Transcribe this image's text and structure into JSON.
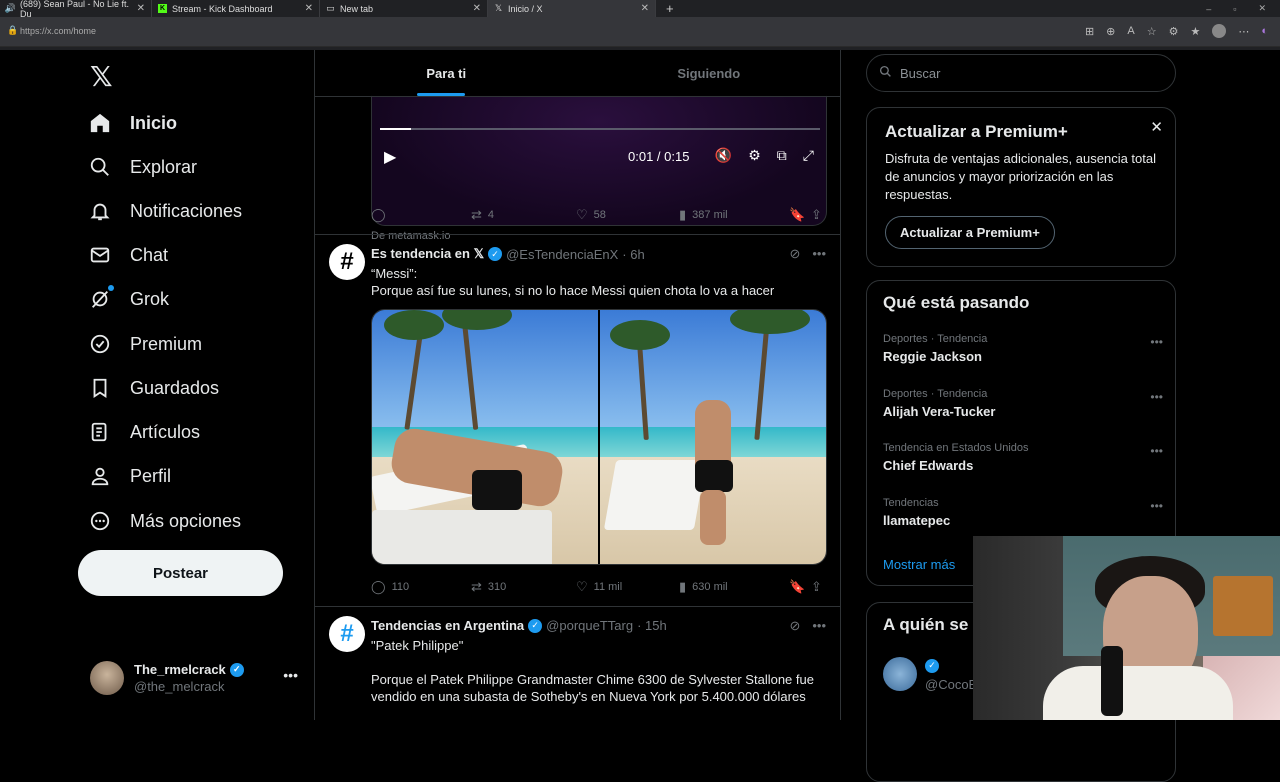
{
  "browser": {
    "tabs": [
      {
        "title": "(689) Sean Paul - No Lie ft. Du",
        "icon": "speaker-icon",
        "active": false
      },
      {
        "title": "Stream - Kick Dashboard",
        "icon": "kick-icon",
        "active": false
      },
      {
        "title": "New tab",
        "icon": "page-icon",
        "active": false
      },
      {
        "title": "Inicio / X",
        "icon": "x-icon",
        "active": true
      }
    ],
    "url": "https://x.com/home"
  },
  "nav": {
    "items": [
      {
        "label": "Inicio",
        "icon": "home-icon"
      },
      {
        "label": "Explorar",
        "icon": "search-icon"
      },
      {
        "label": "Notificaciones",
        "icon": "bell-icon"
      },
      {
        "label": "Chat",
        "icon": "mail-icon"
      },
      {
        "label": "Grok",
        "icon": "grok-icon"
      },
      {
        "label": "Premium",
        "icon": "verified-icon"
      },
      {
        "label": "Guardados",
        "icon": "bookmark-icon"
      },
      {
        "label": "Artículos",
        "icon": "article-icon"
      },
      {
        "label": "Perfil",
        "icon": "person-icon"
      },
      {
        "label": "Más opciones",
        "icon": "more-circle-icon"
      }
    ],
    "post_button": "Postear",
    "profile": {
      "name": "The_rmelcrack",
      "handle": "@the_melcrack"
    }
  },
  "feed": {
    "tabs": [
      "Para ti",
      "Siguiendo"
    ],
    "video_post": {
      "time": "0:01 / 0:15",
      "progress": 0.07,
      "source": "De metamask.io",
      "reposts": "4",
      "likes": "58",
      "views": "387 mil"
    },
    "post1": {
      "name": "Es tendencia en 𝕏",
      "handle": "@EsTendenciaEnX",
      "time": "· 6h",
      "line1": "“Messi”:",
      "line2": "Porque así fue su lunes, si no lo hace Messi quien chota lo va a hacer",
      "replies": "110",
      "reposts": "310",
      "likes": "11 mil",
      "views": "630 mil"
    },
    "post2": {
      "name": "Tendencias en Argentina",
      "handle": "@porqueTTarg",
      "time": "· 15h",
      "line1": "\"Patek Philippe\"",
      "body": "Porque el Patek Philippe Grandmaster Chime 6300 de Sylvester Stallone fue vendido en una subasta de Sotheby's en Nueva York por 5.400.000 dólares"
    }
  },
  "sidebar": {
    "search_placeholder": "Buscar",
    "premium": {
      "title": "Actualizar a Premium+",
      "desc": "Disfruta de ventajas adicionales, ausencia total de anuncios y mayor priorización en las respuestas.",
      "button": "Actualizar a Premium+"
    },
    "trends": {
      "title": "Qué está pasando",
      "items": [
        {
          "context": "Deportes · Tendencia",
          "name": "Reggie Jackson"
        },
        {
          "context": "Deportes · Tendencia",
          "name": "Alijah Vera-Tucker"
        },
        {
          "context": "Tendencia en Estados Unidos",
          "name": "Chief Edwards"
        },
        {
          "context": "Tendencias",
          "name": "llamatepec"
        }
      ],
      "show_more": "Mostrar más"
    },
    "who_to_follow": {
      "title": "A quién se",
      "handle": "@CocoE"
    }
  },
  "colors": {
    "accent": "#1d9bf0",
    "bg": "#000000",
    "border": "#2f3336",
    "muted": "#71767b"
  }
}
